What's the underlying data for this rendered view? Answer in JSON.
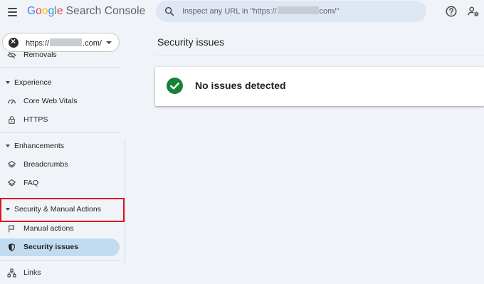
{
  "header": {
    "logo": {
      "g1": "G",
      "g2": "o",
      "g3": "o",
      "g4": "g",
      "g5": "l",
      "g6": "e",
      "product": "Search Console"
    },
    "search": {
      "prefix": "Inspect any URL in \"https://",
      "suffix": "com/\""
    }
  },
  "sidebar": {
    "property": {
      "prefix": "https://",
      "suffix": ".com/"
    },
    "cut_item_label": "Removals",
    "sections": [
      {
        "title": "Experience",
        "items": [
          {
            "label": "Core Web Vitals",
            "icon": "core-web-vitals-icon"
          },
          {
            "label": "HTTPS",
            "icon": "lock-icon"
          }
        ]
      },
      {
        "title": "Enhancements",
        "items": [
          {
            "label": "Breadcrumbs",
            "icon": "layers-icon"
          },
          {
            "label": "FAQ",
            "icon": "layers-icon"
          }
        ]
      },
      {
        "title": "Security & Manual Actions",
        "items": [
          {
            "label": "Manual actions",
            "icon": "flag-icon"
          },
          {
            "label": "Security issues",
            "icon": "shield-icon",
            "active": true
          }
        ]
      }
    ],
    "links_label": "Links"
  },
  "main": {
    "title": "Security issues",
    "status": "No issues detected"
  },
  "colors": {
    "accent_active": "#c2dbf0",
    "success": "#188038",
    "highlight": "#e0101e",
    "background": "#f0f4f9"
  }
}
